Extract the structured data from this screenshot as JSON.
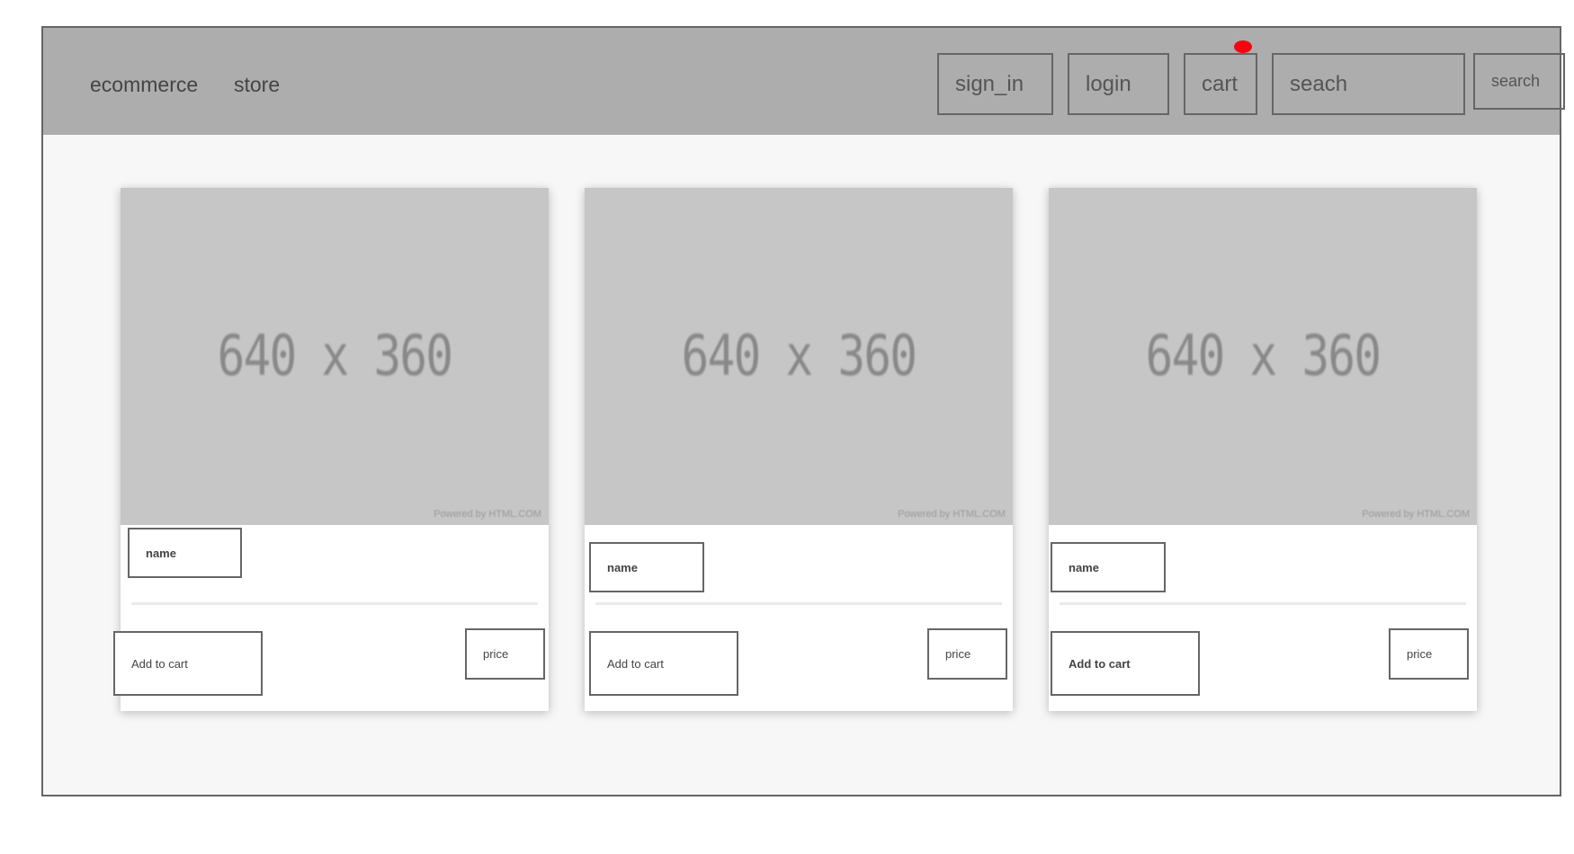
{
  "header": {
    "brand_primary": "ecommerce",
    "brand_secondary": "store",
    "sign_in_label": "sign_in",
    "login_label": "login",
    "cart_label": "cart",
    "search_placeholder": "seach",
    "search_button_label": "search"
  },
  "colors": {
    "header_bg": "#adadad",
    "cart_badge": "#ff0011",
    "image_placeholder": "#c6c6c6"
  },
  "products": [
    {
      "image_label": "640 x 360",
      "image_credit": "Powered by HTML.COM",
      "name_label": "name",
      "add_to_cart_label": "Add to cart",
      "price_label": "price"
    },
    {
      "image_label": "640 x 360",
      "image_credit": "Powered by HTML.COM",
      "name_label": "name",
      "add_to_cart_label": "Add to cart",
      "price_label": "price"
    },
    {
      "image_label": "640 x 360",
      "image_credit": "Powered by HTML.COM",
      "name_label": "name",
      "add_to_cart_label": "Add to cart",
      "price_label": "price"
    }
  ]
}
